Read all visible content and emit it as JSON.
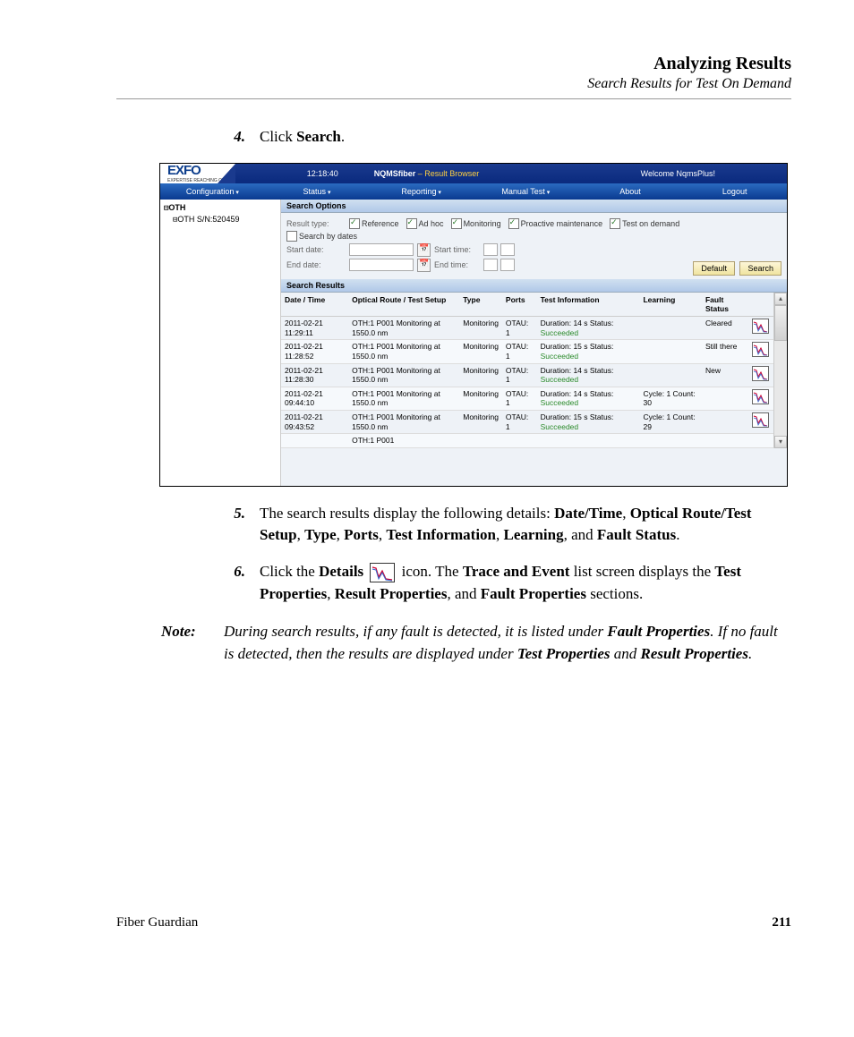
{
  "header": {
    "title": "Analyzing Results",
    "subtitle": "Search Results for Test On Demand"
  },
  "steps": {
    "s4num": "4.",
    "s4a": "Click ",
    "s4b": "Search",
    "s4c": ".",
    "s5num": "5.",
    "s5a": "The search results display the following details: ",
    "s5fields": [
      "Date/Time",
      "Optical Route/Test Setup",
      "Type",
      "Ports",
      "Test Information",
      "Learning",
      "Fault Status"
    ],
    "s5and": ", and ",
    "s5dot": ".",
    "s6num": "6.",
    "s6a": "Click the ",
    "s6b": "Details",
    "s6c": " icon. The ",
    "s6d": "Trace and Event",
    "s6e": " list screen displays the ",
    "s6f": "Test Properties",
    "s6g": ", ",
    "s6h": "Result Properties",
    "s6i": ", and ",
    "s6j": "Fault Properties",
    "s6k": " sections."
  },
  "note": {
    "label": "Note:",
    "a": "During search results, if any fault is detected, it is listed under ",
    "b": "Fault Properties",
    "c": ". If no fault is detected, then the results are displayed under ",
    "d": "Test Properties",
    "e": " and ",
    "f": "Result Properties",
    "g": "."
  },
  "footer": {
    "product": "Fiber Guardian",
    "page": "211"
  },
  "app": {
    "logo": "EXFO",
    "logosub": "EXPERTISE REACHING OUT",
    "time": "12:18:40",
    "name": "NQMSfiber",
    "sub": " – Result Browser",
    "welcome": "Welcome NqmsPlus!",
    "menu": [
      "Configuration",
      "Status",
      "Reporting",
      "Manual Test",
      "About",
      "Logout"
    ],
    "tree": {
      "root": "OTH",
      "child": "OTH S/N:520459"
    },
    "opt": {
      "title": "Search Options",
      "resultType": "Result type:",
      "cb": [
        "Reference",
        "Ad hoc",
        "Monitoring",
        "Proactive maintenance",
        "Test on demand"
      ],
      "searchByDates": "Search by dates",
      "startDate": "Start date:",
      "startTime": "Start time:",
      "endDate": "End date:",
      "endTime": "End time:",
      "default": "Default",
      "search": "Search"
    },
    "res": {
      "title": "Search Results",
      "cols": [
        "Date / Time",
        "Optical Route / Test Setup",
        "Type",
        "Ports",
        "Test Information",
        "Learning",
        "Fault Status"
      ],
      "rows": [
        {
          "dt": "2011-02-21 11:29:11",
          "r": "OTH:1 P001 Monitoring at 1550.0 nm",
          "t": "Monitoring",
          "p": "OTAU: 1",
          "i": "Duration: 14 s Status:",
          "st": "Succeeded",
          "l": "",
          "f": "Cleared"
        },
        {
          "dt": "2011-02-21 11:28:52",
          "r": "OTH:1 P001 Monitoring at 1550.0 nm",
          "t": "Monitoring",
          "p": "OTAU: 1",
          "i": "Duration: 15 s Status:",
          "st": "Succeeded",
          "l": "",
          "f": "Still there"
        },
        {
          "dt": "2011-02-21 11:28:30",
          "r": "OTH:1 P001 Monitoring at 1550.0 nm",
          "t": "Monitoring",
          "p": "OTAU: 1",
          "i": "Duration: 14 s Status:",
          "st": "Succeeded",
          "l": "",
          "f": "New"
        },
        {
          "dt": "2011-02-21 09:44:10",
          "r": "OTH:1 P001 Monitoring at 1550.0 nm",
          "t": "Monitoring",
          "p": "OTAU: 1",
          "i": "Duration: 14 s Status:",
          "st": "Succeeded",
          "l": "Cycle: 1 Count: 30",
          "f": ""
        },
        {
          "dt": "2011-02-21 09:43:52",
          "r": "OTH:1 P001 Monitoring at 1550.0 nm",
          "t": "Monitoring",
          "p": "OTAU: 1",
          "i": "Duration: 15 s Status:",
          "st": "Succeeded",
          "l": "Cycle: 1 Count: 29",
          "f": ""
        }
      ],
      "partial": "OTH:1 P001"
    }
  }
}
